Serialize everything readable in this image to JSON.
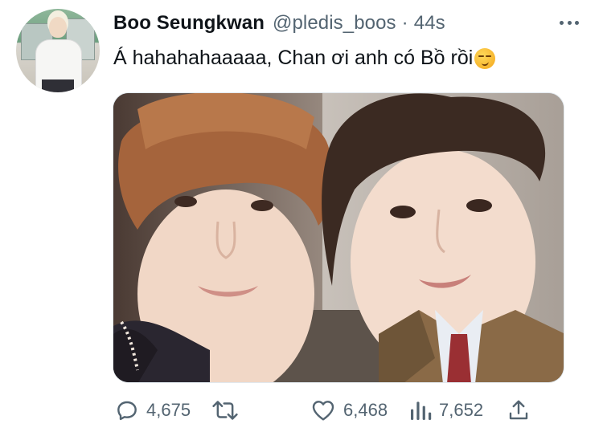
{
  "tweet": {
    "author_name": "Boo Seungkwan",
    "author_handle": "@pledis_boos",
    "separator": "·",
    "timestamp": "44s",
    "text": "Á hahahahaaaaa, Chan ơi anh có Bồ rồi",
    "text_emoji": "smirking-face-emoji"
  },
  "actions": {
    "reply_count": "4,675",
    "retweet_count": "",
    "like_count": "6,468",
    "views_count": "7,652"
  },
  "icons": {
    "reply": "reply-icon",
    "retweet": "retweet-icon",
    "like": "heart-icon",
    "views": "views-icon",
    "share": "share-icon",
    "more": "more-icon"
  },
  "colors": {
    "text_primary": "#0f1419",
    "text_secondary": "#536471"
  }
}
